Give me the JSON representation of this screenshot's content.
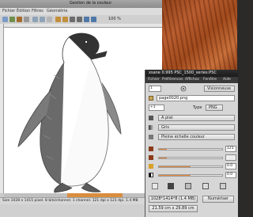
{
  "editor": {
    "title": "Gestion de la couleur",
    "menu": [
      "Fichier",
      "Édition",
      "Filtres",
      "Géométrie"
    ],
    "zoom": "100 %",
    "status": "Size 1028 x 1415 pixel. 8 bits/channel. 1 channel. 121 dpi x 121 dpi. 1.4 MB"
  },
  "dialog": {
    "title": "xsane 0.995 PSC_1500_series:PSC",
    "menu": [
      "Fichier",
      "Préférences",
      "Affichez",
      "Fenêtre",
      "Aide"
    ],
    "copies": "1",
    "target": "Visionneuse",
    "filename": "page0020.png",
    "counter": "+1",
    "type_label": "Type",
    "type_value": "PNG",
    "source": "A plat",
    "mode": "Gris",
    "range": "Pleine échelle couleur",
    "resolution": "121",
    "brightness": "0.0",
    "contrast": "0.0",
    "image_size": "1028*1414*8 (1.4 MB)",
    "dimensions": "21.59 cm x 29.89 cm",
    "scan_button": "Numériser"
  }
}
